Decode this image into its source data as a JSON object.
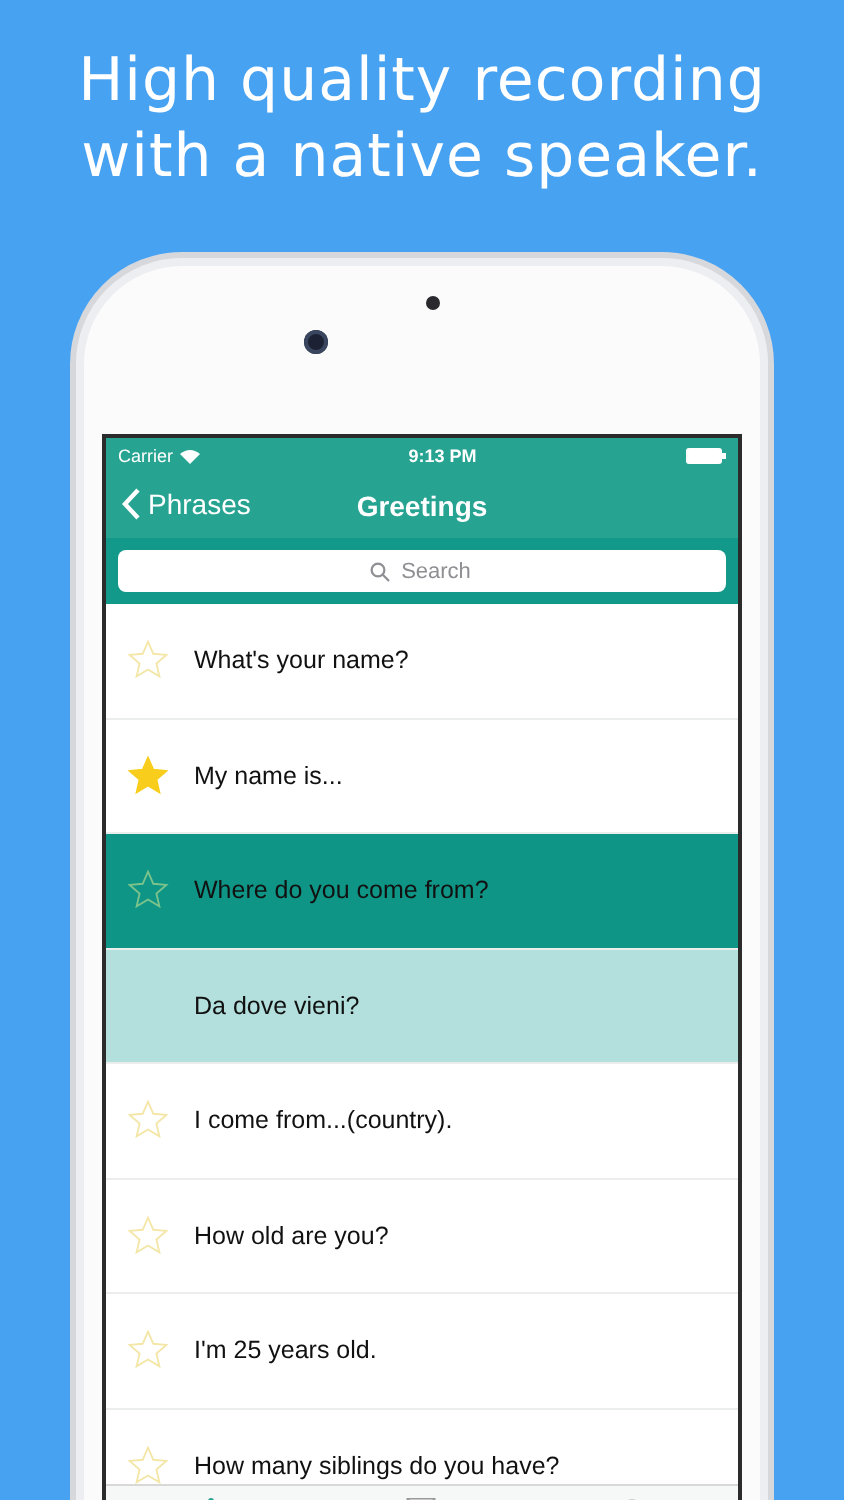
{
  "headline": "High quality recording with a native speaker.",
  "status_bar": {
    "carrier": "Carrier",
    "time": "9:13 PM"
  },
  "nav_bar": {
    "back": "Phrases",
    "title": "Greetings"
  },
  "search": {
    "placeholder": "Search"
  },
  "rows": [
    {
      "kind": "phrase",
      "text": "What's your name?",
      "favorite": false,
      "selected": false
    },
    {
      "kind": "phrase",
      "text": "My name is...",
      "favorite": true,
      "selected": false
    },
    {
      "kind": "phrase",
      "text": "Where do you come from?",
      "favorite": false,
      "selected": true
    },
    {
      "kind": "translation",
      "text": "Da dove vieni?"
    },
    {
      "kind": "phrase",
      "text": "I come from...(country).",
      "favorite": false,
      "selected": false
    },
    {
      "kind": "phrase",
      "text": "How old are you?",
      "favorite": false,
      "selected": false
    },
    {
      "kind": "phrase",
      "text": "I'm 25 years old.",
      "favorite": false,
      "selected": false
    },
    {
      "kind": "phrase",
      "text": "How many siblings do you have?",
      "favorite": false,
      "selected": false
    }
  ],
  "tab_bar": [
    {
      "selected": true
    },
    {
      "selected": false
    },
    {
      "selected": false
    }
  ]
}
